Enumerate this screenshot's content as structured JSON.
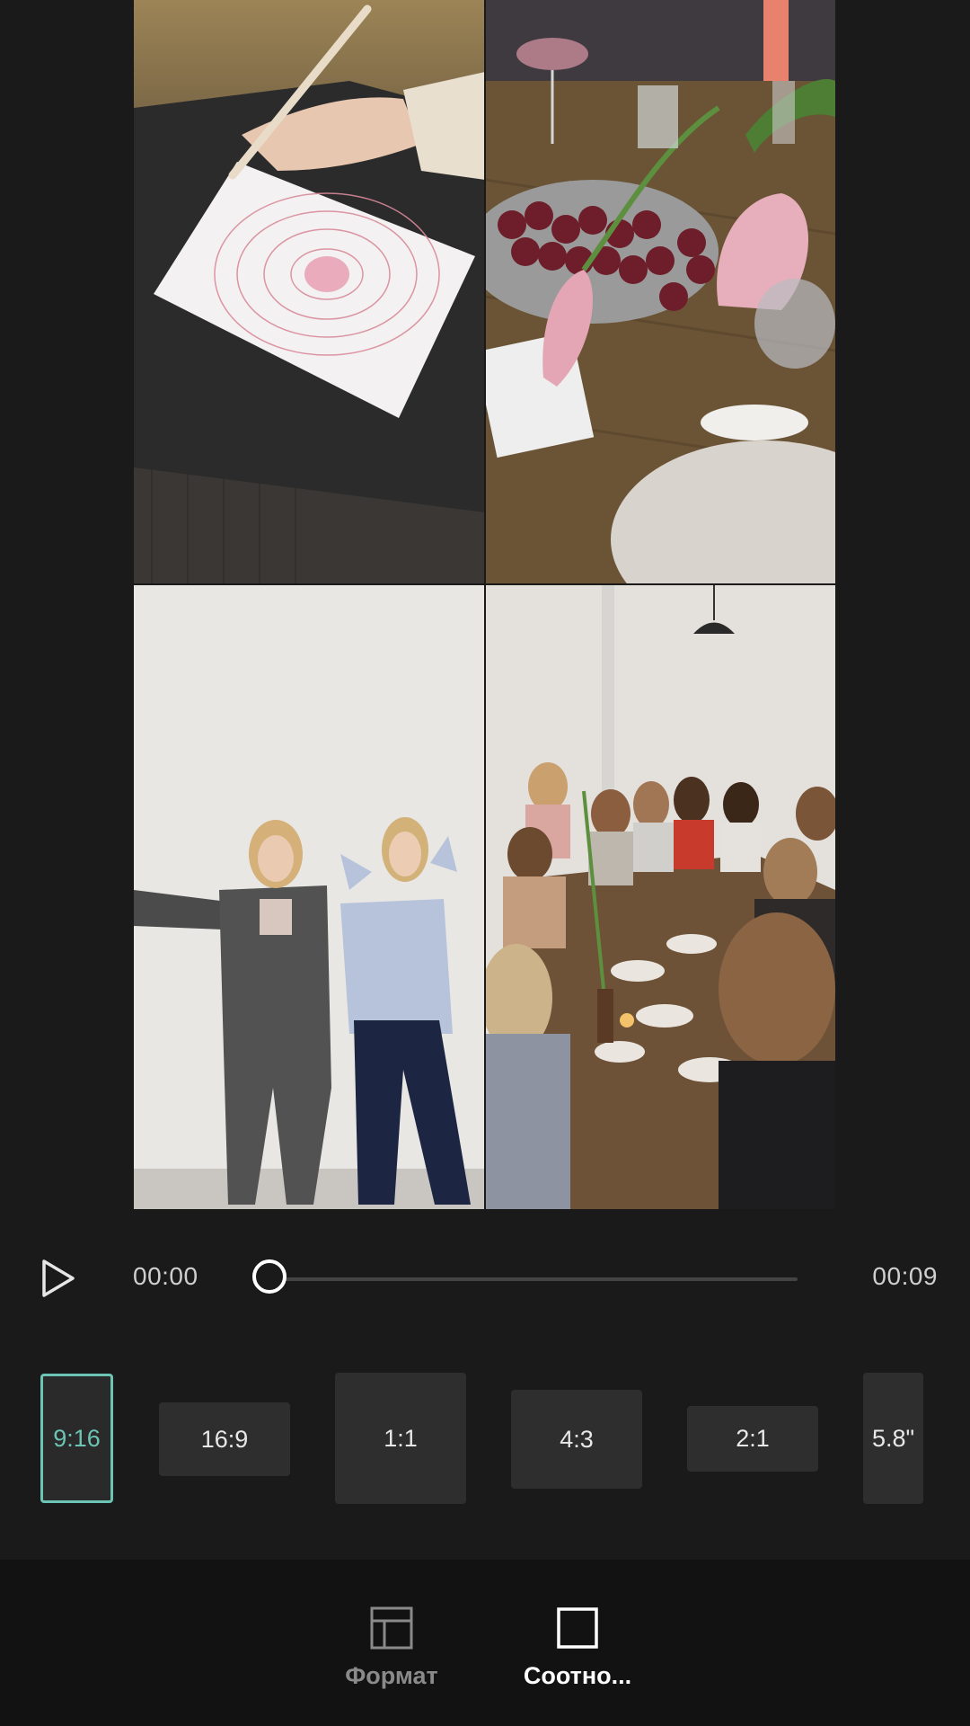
{
  "player": {
    "current_time": "00:00",
    "total_time": "00:09",
    "progress": 0
  },
  "ratios": {
    "options": [
      "9:16",
      "16:9",
      "1:1",
      "4:3",
      "2:1",
      "5.8\""
    ],
    "selected": "9:16"
  },
  "toolbar": {
    "format_label": "Формат",
    "ratio_label": "Соотно..."
  },
  "colors": {
    "accent": "#6cc4b4",
    "background": "#1a1a1a",
    "toolbar_background": "#121212",
    "option_background": "#2e2e2e"
  }
}
